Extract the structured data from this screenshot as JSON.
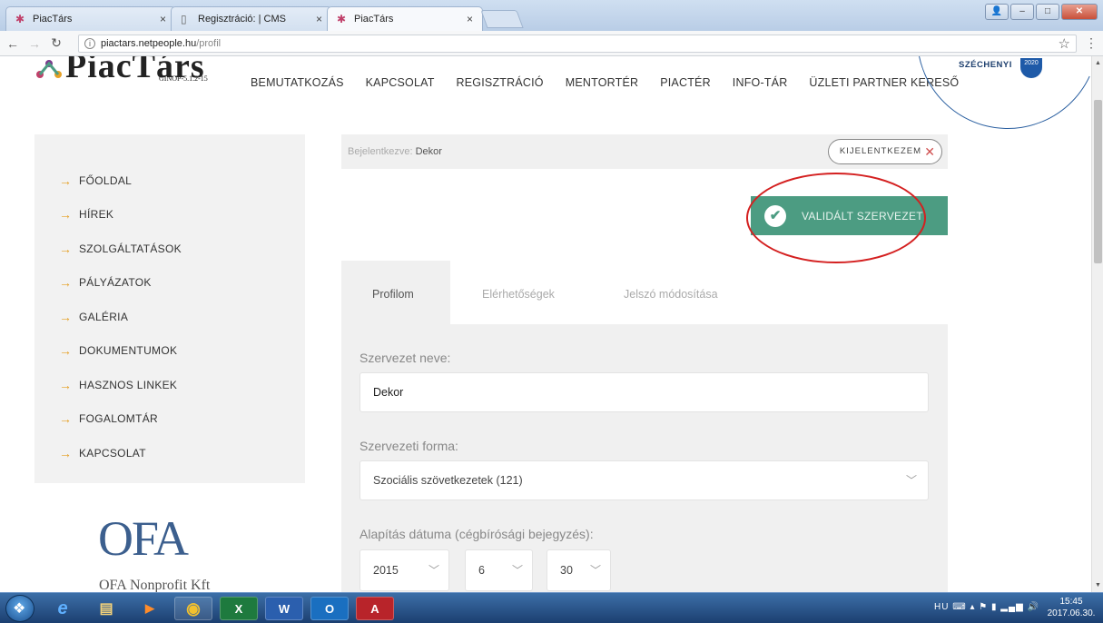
{
  "browser": {
    "tabs": [
      {
        "label": "PiacTárs",
        "close": "×"
      },
      {
        "label": "Regisztráció: | CMS",
        "close": "×"
      },
      {
        "label": "PiacTárs",
        "close": "×"
      }
    ],
    "url_host": "piactars.netpeople.hu",
    "url_path": "/profil"
  },
  "site": {
    "logo_text": "PiacTárs",
    "logo_sub": "GINOP-5.1.2-15",
    "nav": [
      "BEMUTATKOZÁS",
      "KAPCSOLAT",
      "REGISZTRÁCIÓ",
      "MENTORTÉR",
      "PIACTÉR",
      "INFO-TÁR",
      "ÜZLETI PARTNER KERESŐ"
    ],
    "szechenyi": "SZÉCHENYI",
    "szechenyi_badge": "2020"
  },
  "sidebar": {
    "items": [
      "FŐOLDAL",
      "HÍREK",
      "SZOLGÁLTATÁSOK",
      "PÁLYÁZATOK",
      "GALÉRIA",
      "DOKUMENTUMOK",
      "HASZNOS LINKEK",
      "FOGALOMTÁR",
      "KAPCSOLAT"
    ],
    "ofa_logo": "OFA",
    "ofa_sub": "OFA Nonprofit Kft"
  },
  "login": {
    "prefix": "Bejelentkezve:",
    "user": "Dekor",
    "logout_label": "KIJELENTKEZEM"
  },
  "status": {
    "validated_label": "VALIDÁLT SZERVEZET"
  },
  "tabs": [
    "Profilom",
    "Elérhetőségek",
    "Jelszó módosítása"
  ],
  "form": {
    "org_name_label": "Szervezet neve:",
    "org_name_value": "Dekor",
    "org_form_label": "Szervezeti forma:",
    "org_form_value": "Szociális szövetkezetek (121)",
    "founding_label": "Alapítás dátuma (cégbírósági bejegyzés):",
    "year": "2015",
    "month": "6",
    "day": "30"
  },
  "taskbar": {
    "lang": "HU",
    "time": "15:45",
    "date": "2017.06.30."
  },
  "colors": {
    "accent_green": "#4c9c82",
    "arrow_orange": "#e6a126",
    "highlight_red": "#d42020"
  }
}
